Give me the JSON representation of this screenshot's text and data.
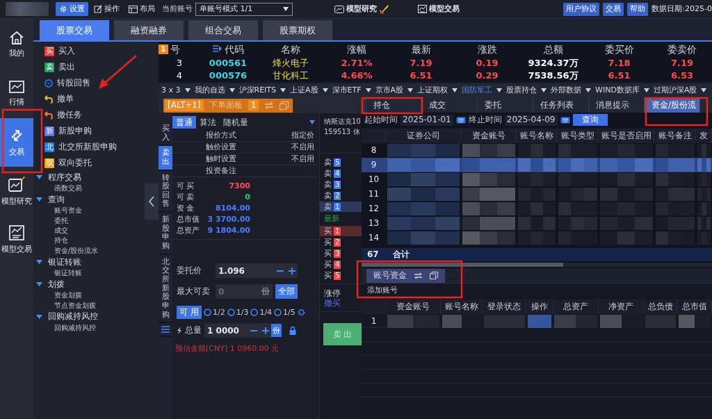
{
  "top_bar": {
    "tools": [
      {
        "label": "设置",
        "kind": "settings",
        "selected": true
      },
      {
        "label": "操作",
        "kind": "edit",
        "selected": false
      },
      {
        "label": "布局",
        "kind": "layout",
        "selected": false
      }
    ],
    "account_label": "当前账号",
    "account_mode": "单账号模式 1/1",
    "center_links": [
      {
        "label": "模型研究",
        "kind": "research"
      },
      {
        "label": "模型交易",
        "kind": "trade"
      }
    ],
    "buttons": [
      "用户协议",
      "交易",
      "帮助"
    ],
    "data_date": "数据日期:2025-0"
  },
  "nav": [
    {
      "label": "我的",
      "kind": "home",
      "selected": false
    },
    {
      "label": "行情",
      "kind": "market",
      "selected": false
    },
    {
      "label": "交易",
      "kind": "trade",
      "selected": true
    },
    {
      "label": "模型研究",
      "kind": "research",
      "selected": false
    },
    {
      "label": "模型交易",
      "kind": "model",
      "selected": false
    }
  ],
  "main_tabs": [
    {
      "label": "股票交易",
      "selected": true
    },
    {
      "label": "融资融券",
      "selected": false
    },
    {
      "label": "组合交易",
      "selected": false
    },
    {
      "label": "股票期权",
      "selected": false
    }
  ],
  "menu": {
    "actions": [
      {
        "label": "买入",
        "kind": "badge",
        "badge": "买",
        "color": "#e53935"
      },
      {
        "label": "卖出",
        "kind": "badge",
        "badge": "卖",
        "color": "#1e9e55"
      },
      {
        "label": "转股回售",
        "kind": "convert",
        "color": "#1e6fd9"
      },
      {
        "label": "撤单",
        "kind": "undo",
        "color": "#e8b23a"
      },
      {
        "label": "撤任务",
        "kind": "undo",
        "color": "#f07a2a"
      },
      {
        "label": "新股申购",
        "kind": "badge",
        "badge": "新",
        "color": "#5b6fe6"
      },
      {
        "label": "北交所新股申购",
        "kind": "badge",
        "badge": "北",
        "color": "#1e7be6"
      },
      {
        "label": "双向委托",
        "kind": "badge",
        "badge": "双",
        "color": "#f0a31f"
      }
    ],
    "sections": [
      {
        "label": "程序交易",
        "expanded": true,
        "children": [
          "函数交易"
        ]
      },
      {
        "label": "查询",
        "expanded": true,
        "children": [
          "账号资金",
          "委托",
          "成交",
          "持仓",
          "资金/股份流水"
        ]
      },
      {
        "label": "银证转账",
        "expanded": true,
        "children": [
          "银证转账"
        ]
      },
      {
        "label": "划拨",
        "expanded": true,
        "children": [
          "资金划拨",
          "节点资金划拨"
        ]
      },
      {
        "label": "回购减持风控",
        "expanded": true,
        "children": [
          "回购减持风控"
        ]
      }
    ]
  },
  "quote_table": {
    "badge": "1",
    "columns": [
      {
        "label": "号",
        "kind": "index"
      },
      {
        "label": "代码",
        "kind": "code"
      },
      {
        "label": "名称",
        "kind": "name"
      },
      {
        "label": "涨幅",
        "kind": "up"
      },
      {
        "label": "最新",
        "kind": "up"
      },
      {
        "label": "涨跌",
        "kind": "up"
      },
      {
        "label": "总额",
        "kind": "plain"
      },
      {
        "label": "委买价",
        "kind": "up"
      },
      {
        "label": "委卖价",
        "kind": "up"
      }
    ],
    "rows": [
      [
        "3",
        "000561",
        "烽火电子",
        "2.71%",
        "7.19",
        "0.19",
        "9324.37万",
        "7.18",
        "7.19"
      ],
      [
        "4",
        "000576",
        "甘化科工",
        "4.66%",
        "6.51",
        "0.29",
        "7538.56万",
        "6.51",
        "6.53"
      ]
    ]
  },
  "sector_tabs": [
    {
      "label": "3 x 3",
      "selected": false
    },
    {
      "label": "我的自选",
      "selected": false
    },
    {
      "label": "沪深REITS",
      "selected": false
    },
    {
      "label": "上证A股",
      "selected": false
    },
    {
      "label": "深市ETF",
      "selected": false
    },
    {
      "label": "京市A股",
      "selected": false
    },
    {
      "label": "上证期权",
      "selected": false
    },
    {
      "label": "国防军工",
      "selected": true
    },
    {
      "label": "股票持仓",
      "selected": false
    },
    {
      "label": "外部数据",
      "selected": false
    },
    {
      "label": "WIND数据库",
      "selected": false
    },
    {
      "label": "过期沪深A股",
      "selected": false
    }
  ],
  "order_panel": {
    "hotkey": "[ALT+1]",
    "title": "下单面板",
    "count": "1",
    "side_tabs": [
      {
        "label": "买入",
        "selected": false
      },
      {
        "label": "卖出",
        "selected": true
      },
      {
        "label": "转股回售",
        "selected": false
      },
      {
        "label": "新股申购",
        "selected": false
      },
      {
        "label": "北交所新股申购",
        "selected": false
      }
    ],
    "algo_tabs": [
      {
        "label": "普通",
        "selected": true
      },
      {
        "label": "算法",
        "selected": false
      },
      {
        "label": "随机量",
        "selected": false
      }
    ],
    "settings": [
      {
        "label": "报价方式",
        "value": "指定价"
      },
      {
        "label": "触价设置",
        "value": "不启用"
      },
      {
        "label": "触时设置",
        "value": "不启用"
      },
      {
        "label": "投资备注"
      }
    ],
    "stats": [
      {
        "label": "可 买",
        "value": "7300",
        "color": "#ff4d5a"
      },
      {
        "label": "可 卖",
        "value": "0",
        "color": "#2ecc71"
      },
      {
        "label": "资 金",
        "value": "8104.00",
        "color": "#4f7dff"
      },
      {
        "label": "总市值",
        "value": "3 3700.00",
        "color": "#4f7dff"
      },
      {
        "label": "总资产",
        "value": "9 1804.00",
        "color": "#4f7dff"
      }
    ],
    "price": {
      "label": "委托价",
      "value": "1.096"
    },
    "max_sell": {
      "label": "最大可卖",
      "placeholder": "0",
      "unit": "份",
      "button": "全部"
    },
    "ratio": {
      "label": "可 用",
      "options": [
        {
          "label": "1/2",
          "checked": false
        },
        {
          "label": "1/3",
          "checked": false
        },
        {
          "label": "1/4",
          "checked": false
        },
        {
          "label": "1/5",
          "checked": false
        }
      ]
    },
    "quantity": {
      "label": "总量",
      "value": "1 0000",
      "unit": "份"
    },
    "estimate": "预估金额[CNY] 1 0960.00 元",
    "submit": "卖 出"
  },
  "depth": {
    "name": "纳斯达克10",
    "code": "159513",
    "status": "休",
    "levels": [
      {
        "kind": "sell",
        "label": "卖",
        "num": "5",
        "selected": false
      },
      {
        "kind": "sell",
        "label": "卖",
        "num": "4",
        "selected": false
      },
      {
        "kind": "sell",
        "label": "卖",
        "num": "3",
        "selected": false
      },
      {
        "kind": "sell",
        "label": "卖",
        "num": "2",
        "selected": false
      },
      {
        "kind": "sell",
        "label": "卖",
        "num": "1",
        "selected": true
      },
      {
        "kind": "last",
        "label": "最新",
        "selected": false
      },
      {
        "kind": "buy",
        "label": "买",
        "num": "1",
        "selected": true
      },
      {
        "kind": "buy",
        "label": "买",
        "num": "2",
        "selected": false
      },
      {
        "kind": "buy",
        "label": "买",
        "num": "3",
        "selected": false
      },
      {
        "kind": "buy",
        "label": "买",
        "num": "4",
        "selected": false
      },
      {
        "kind": "buy",
        "label": "买",
        "num": "5",
        "selected": false
      }
    ],
    "limit_label": "涨停",
    "cancel_label": "撤买"
  },
  "positions_panel": {
    "tabs": [
      {
        "label": "持仓",
        "selected": false
      },
      {
        "label": "成交",
        "selected": false
      },
      {
        "label": "委托",
        "selected": false
      },
      {
        "label": "任务列表",
        "selected": false
      },
      {
        "label": "消息提示",
        "selected": false
      },
      {
        "label": "资金/股份流",
        "selected": true
      }
    ],
    "filter": {
      "start_label": "起始时间",
      "start": "2025-01-01",
      "end_label": "终止时间",
      "end": "2025-04-09",
      "button": "查询"
    },
    "table": {
      "columns": [
        "证券公司",
        "资金账号",
        "账号名称",
        "账号类型",
        "账号是否启用",
        "账号备注",
        "发"
      ],
      "rows": [
        {
          "num": "8",
          "selected": false
        },
        {
          "num": "9",
          "selected": true
        },
        {
          "num": "10",
          "selected": false
        },
        {
          "num": "11",
          "selected": false
        },
        {
          "num": "12",
          "selected": false
        },
        {
          "num": "13",
          "selected": false
        },
        {
          "num": "14",
          "selected": false
        }
      ]
    },
    "total": {
      "count": "67",
      "label": "合计"
    }
  },
  "accounts_panel": {
    "tab": "账号资金",
    "add_label": "添加账号",
    "table": {
      "columns": [
        "资金账号",
        "账号名称",
        "登录状态",
        "操作",
        "总资产",
        "净资产",
        "总负债",
        "总市值"
      ],
      "rows": [
        {
          "num": "1"
        }
      ]
    }
  }
}
